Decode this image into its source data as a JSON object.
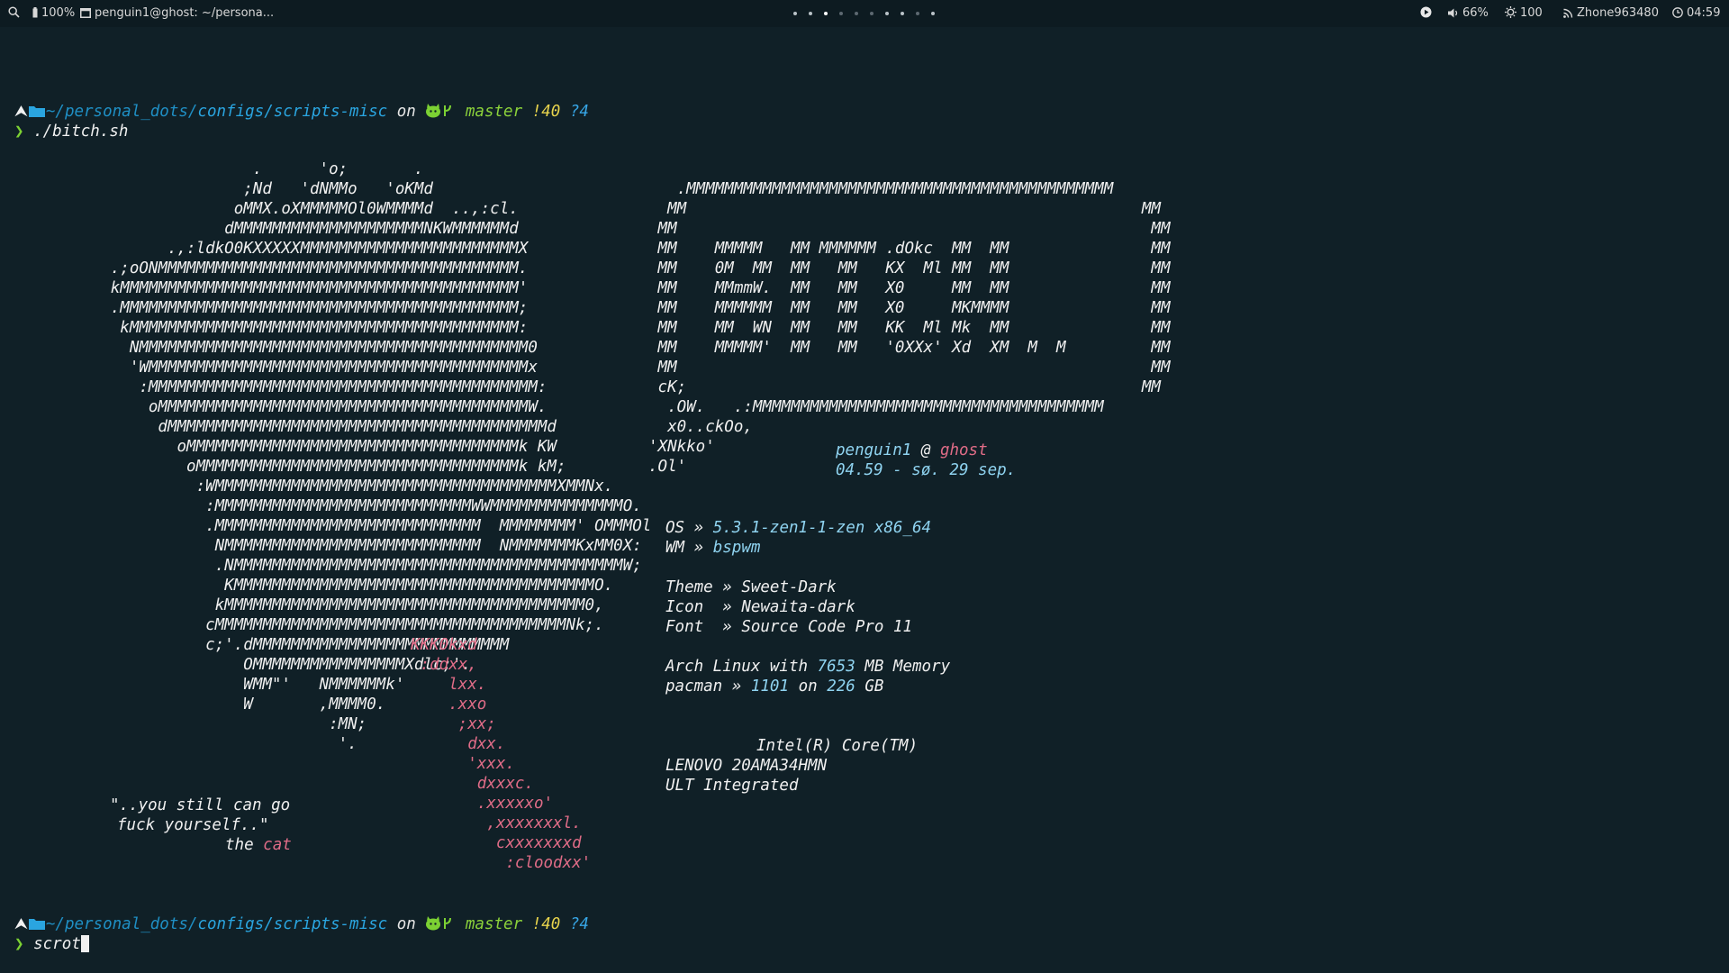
{
  "topbar": {
    "battery": "100%",
    "window_title": "penguin1@ghost: ~/persona...",
    "workspaces": [
      "occupied",
      "occupied",
      "active",
      "empty",
      "empty",
      "empty",
      "occupied",
      "occupied",
      "empty",
      "occupied"
    ],
    "volume": "66%",
    "brightness": "100",
    "network": "Zhone963480",
    "clock": "04:59"
  },
  "prompt": {
    "path_prefix": "~/personal_dots/",
    "path_rest": "configs/scripts-misc",
    "on": "on",
    "branch": "master",
    "modified": "!40",
    "untracked": "?4",
    "chevron": "❯"
  },
  "commands": {
    "first": "./bitch.sh",
    "second": "scrot"
  },
  "cat_art_white": [
    "                      .      'o;       .",
    "                     ;Nd   'dNMMo   'oKMd",
    "                    oMMX.oXMMMMMOl0WMMMMd  ..,:cl.",
    "                   dMMMMMMMMMMMMMMMMMMMMNKWMMMMMMd",
    "             .,:ldkO0KXXXXXMMMMMMMMMMMMMMMMMMMMMMMX",
    "       .;oONMMMMMMMMMMMMMMMMMMMMMMMMMMMMMMMMMMMMMM.",
    "       kMMMMMMMMMMMMMMMMMMMMMMMMMMMMMMMMMMMMMMMMMM'",
    "       .MMMMMMMMMMMMMMMMMMMMMMMMMMMMMMMMMMMMMMMMMM;",
    "        kMMMMMMMMMMMMMMMMMMMMMMMMMMMMMMMMMMMMMMMMM:",
    "         NMMMMMMMMMMMMMMMMMMMMMMMMMMMMMMMMMMMMMMMMM0",
    "         'WMMMMMMMMMMMMMMMMMMMMMMMMMMMMMMMMMMMMMMMMx",
    "          :MMMMMMMMMMMMMMMMMMMMMMMMMMMMMMMMMMMMMMMMM:",
    "           oMMMMMMMMMMMMMMMMMMMMMMMMMMMMMMMMMMMMMMMW.",
    "            dMMMMMMMMMMMMMMMMMMMMMMMMMMMMMMMMMMMMMMMMd",
    "              oMMMMMMMMMMMMMMMMMMMMMMMMMMMMMMMMMMMk KW",
    "               oMMMMMMMMMMMMMMMMMMMMMMMMMMMMMMMMMMk kM;",
    "                :WMMMMMMMMMMMMMMMMMMMMMMMMMMMMMMMMMMMMXMMNx.",
    "                 :MMMMMMMMMMMMMMMMMMMMMMMMMMMWWMMMMMMMMMMMMMMO.",
    "                 .MMMMMMMMMMMMMMMMMMMMMMMMMMMM  MMMMMMMM' OMMMOl",
    "                  NMMMMMMMMMMMMMMMMMMMMMMMMMMM  NMMMMMMMKxMM0X:",
    "                  .NMMMMMMMMMMMMMMMMMMMMMMMMMMMMMMMMMMMMMMMMMW;",
    "                   KMMMMMMMMMMMMMMMMMMMMMMMMMMMMMMMMMMMMMMO.",
    "                  kMMMMMMMMMMMMMMMMMMMMMMMMMMMMMMMMMMMMMM0,",
    "                 cMMMMMMMMMMMMMMMMMMMMMMMMMMMMMMMMMMMMMNk;.",
    "                 c;'.dMMMMMMMMMMMMMMMMMMMMMMMMMMM",
    "                     OMMMMMMMMMMMMMMMMXdlc;'.",
    "                     WMM\"'   NMMMMMMk'",
    "                     W       ,MMMM0.",
    "                              :MN;",
    "                               '."
  ],
  "cat_tail_pink": [
    "KKK0kxd",
    ":ddxx,",
    "lxx.",
    ".xxo",
    ";xx;",
    "dxx.",
    "'xxx.",
    "dxxxc.",
    ".xxxxxo'",
    ",xxxxxxxl.",
    "cxxxxxxxd",
    ":cloodxx'"
  ],
  "quote": {
    "line1": "\"..you still can go",
    "line2": "fuck yourself..\"",
    "attribution_pre": "the",
    "attribution_name": "cat"
  },
  "mmm_box": [
    "   .MMMMMMMMMMMMMMMMMMMMMMMMMMMMMMMMMMMMMMMMMMMMM",
    "  MM                                                MM",
    " MM                                                  MM",
    " MM    MMMMM   MM MMMMMM .dOkc  MM  MM               MM",
    " MM    0M  MM  MM   MM   KX  Ml MM  MM               MM",
    " MM    MMmmW.  MM   MM   X0     MM  MM               MM",
    " MM    MMMMMM  MM   MM   X0     MKMMMM               MM",
    " MM    MM  WN  MM   MM   KK  Ml Mk  MM               MM",
    " MM    MMMMM'  MM   MM   '0XXx' Xd  XM  M  M         MM",
    " MM                                                  MM",
    " cK;                                                MM",
    "  .OW.   .:MMMMMMMMMMMMMMMMMMMMMMMMMMMMMMMMMMMMM",
    "  x0..ckOo,",
    "'XNkko'",
    ".Ol'"
  ],
  "sysinfo": {
    "user": "penguin1",
    "at": "@",
    "host": "ghost",
    "datetime": "04.59 - sø. 29 sep.",
    "os_label": "OS",
    "os_value": "5.3.1-zen1-1-zen x86_64",
    "wm_label": "WM",
    "wm_value": "bspwm",
    "theme_label": "Theme",
    "theme_value": "Sweet-Dark",
    "icon_label": "Icon ",
    "icon_value": "Newaita-dark",
    "font_label": "Font ",
    "font_value": "Source Code Pro 11",
    "mem_pre": "Arch Linux with",
    "mem_value": "7653",
    "mem_post": "MB Memory",
    "pacman_label": "pacman",
    "pacman_count": "1101",
    "pacman_on": "on",
    "pacman_size": "226",
    "pacman_unit": "GB",
    "cpu": "Intel(R) Core(TM)",
    "vendor": "LENOVO 20AMA34HMN",
    "gpu": "ULT Integrated",
    "separator": "»"
  },
  "colors": {
    "background": "#102027",
    "path": "#1f8fc4",
    "branch": "#8bd13a",
    "status": "#e8d44d",
    "pink": "#e06c87",
    "value_blue": "#8fd3f0"
  }
}
